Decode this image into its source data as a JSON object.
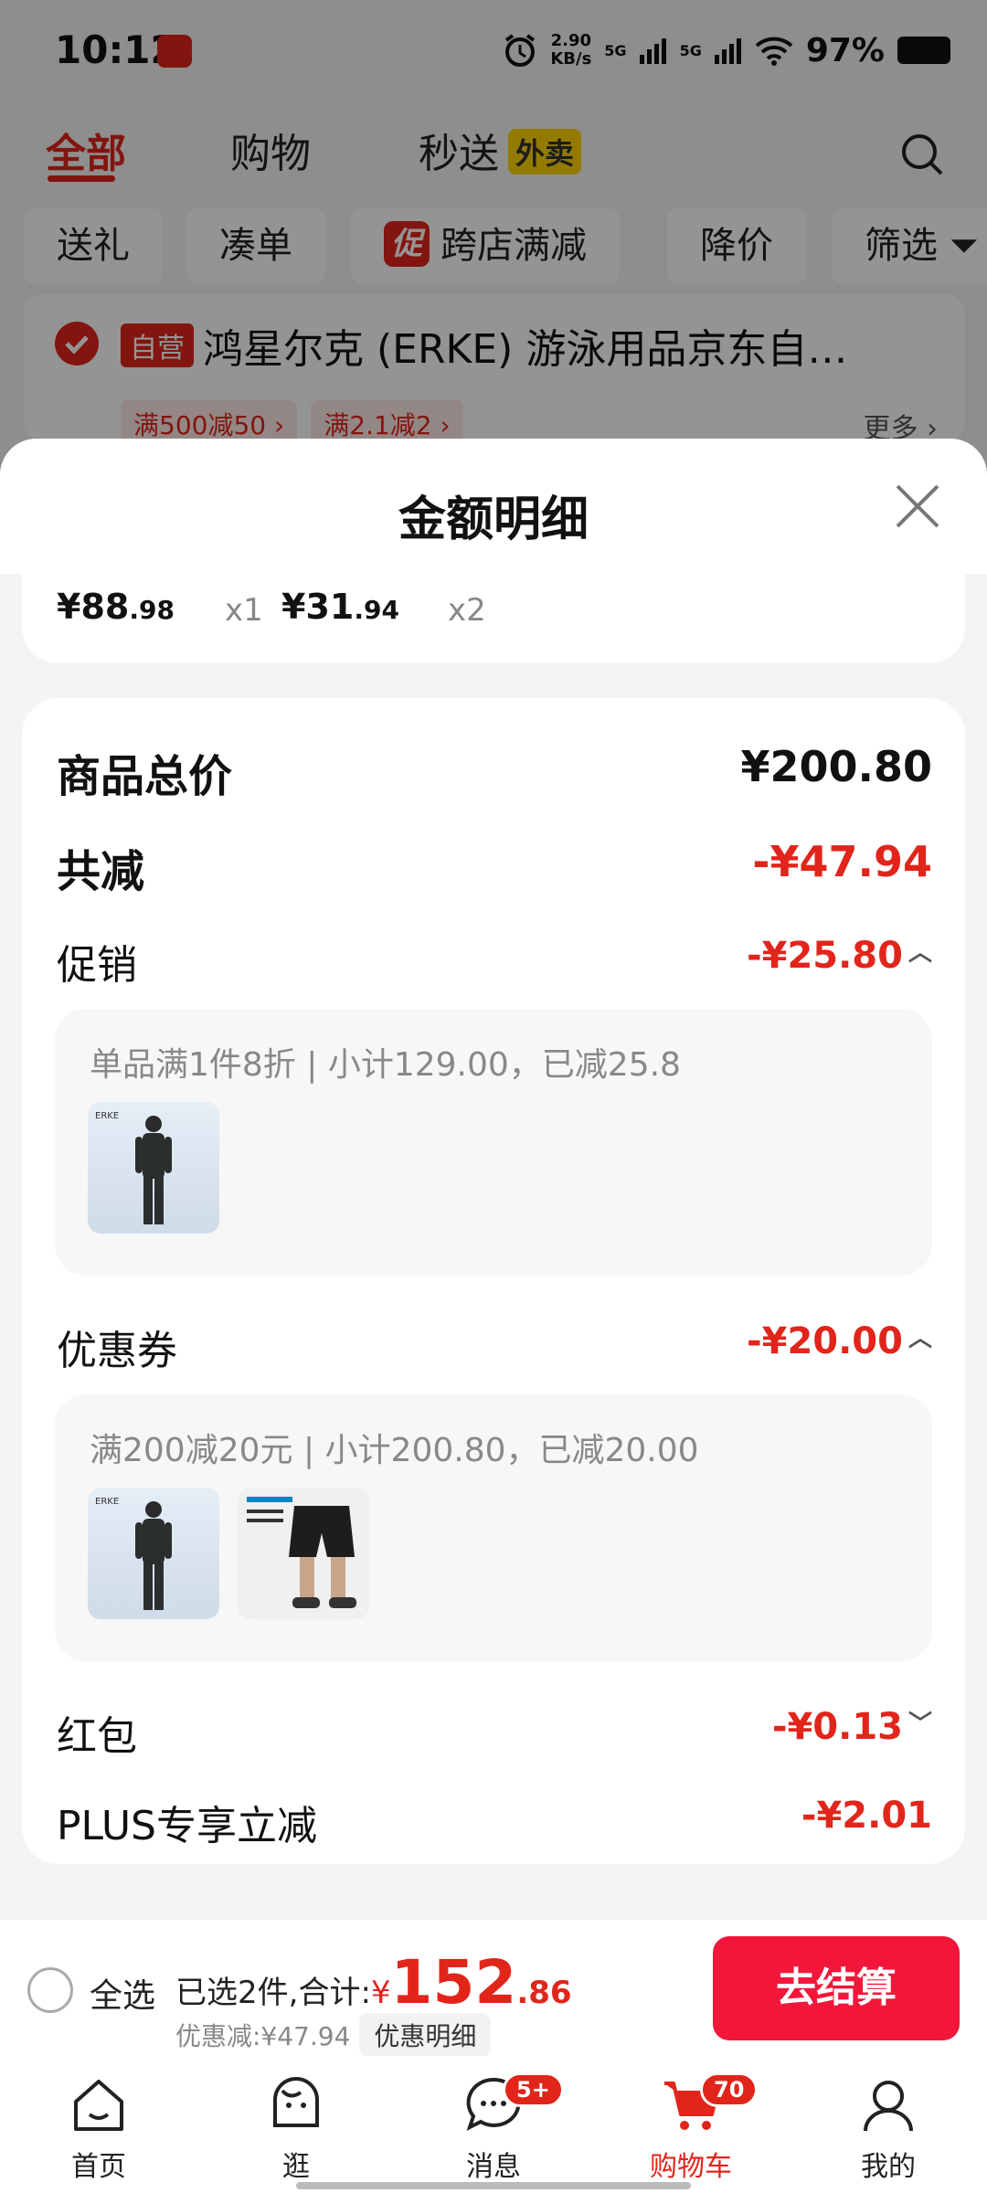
{
  "status_bar": {
    "time": "10:12",
    "net_speed_top": "2.90",
    "net_speed_unit": "KB/s",
    "sig1": "5G",
    "sig2": "5G",
    "battery": "97%"
  },
  "top_tabs": {
    "all": "全部",
    "shopping": "购物",
    "instant": "秒送",
    "instant_badge": "外卖"
  },
  "filter_chips": {
    "gift": "送礼",
    "bundle": "凑单",
    "promo_tag": "促",
    "cross_store": "跨店满减",
    "price_drop": "降价",
    "filter": "筛选"
  },
  "store": {
    "badge": "自营",
    "name": "鸿星尔克 (ERKE) 游泳用品京东自…",
    "promo1": "满500减50 ›",
    "promo2": "满2.1减2 ›",
    "more": "更多 ›"
  },
  "sheet": {
    "title": "金额明细",
    "items": [
      {
        "price_int": "¥88",
        "price_dec": ".98",
        "qty": "x1"
      },
      {
        "price_int": "¥31",
        "price_dec": ".94",
        "qty": "x2"
      }
    ],
    "goods_total_label": "商品总价",
    "goods_total_value": "¥200.80",
    "total_reduce_label": "共减",
    "total_reduce_value": "-¥47.94",
    "promo_label": "促销",
    "promo_value": "-¥25.80",
    "promo_detail": "单品满1件8折 | 小计129.00，已减25.8",
    "coupon_label": "优惠券",
    "coupon_value": "-¥20.00",
    "coupon_detail": "满200减20元 | 小计200.80，已减20.00",
    "redpacket_label": "红包",
    "redpacket_value": "-¥0.13",
    "plus_label": "PLUS专享立减",
    "plus_value": "-¥2.01"
  },
  "checkout": {
    "select_all": "全选",
    "summary_prefix": "已选2件,合计:",
    "currency": "¥",
    "total_int": "152",
    "total_dec": ".86",
    "discount": "优惠减:¥47.94",
    "detail_button": "优惠明细",
    "pay_button": "去结算"
  },
  "bottom_nav": {
    "home": "首页",
    "browse": "逛",
    "messages": "消息",
    "messages_badge": "5+",
    "cart": "购物车",
    "cart_badge": "70",
    "mine": "我的"
  },
  "colors": {
    "accent": "#e1251b",
    "pay_button": "#f2173a"
  }
}
